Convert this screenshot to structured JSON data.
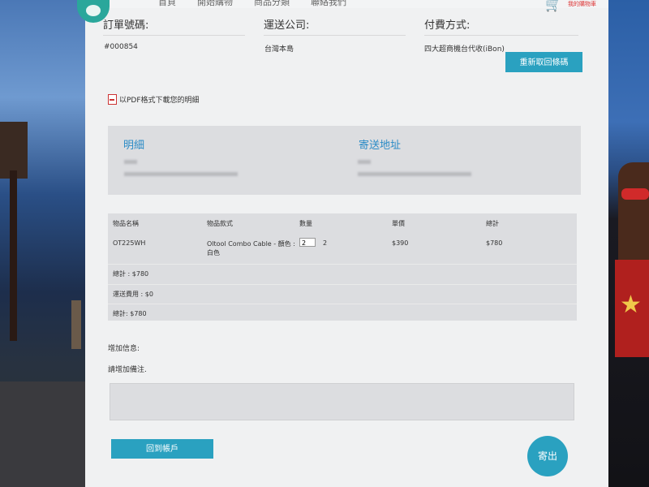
{
  "nav": {
    "items": [
      "首頁",
      "開始購物",
      "商品分類",
      "聯絡我們"
    ],
    "cart_label": "我的購物車"
  },
  "order_info": {
    "order_no_label": "訂單號碼:",
    "order_no": "#000854",
    "shipping_label": "運送公司:",
    "shipping_value": "台灣本島",
    "payment_label": "付費方式:",
    "payment_value": "四大超商機台代收(iBon)",
    "reissue_button": "重新取回條碼"
  },
  "pdf_link": "以PDF格式下載您的明細",
  "address": {
    "details_title": "明細",
    "ship_title": "寄送地址"
  },
  "table": {
    "headers": [
      "物品名稱",
      "物品款式",
      "數量",
      "單價",
      "總計"
    ],
    "rows": [
      {
        "name": "OT225WH",
        "style": "Oltool Combo Cable - 顏色 : 白色",
        "qty_input": "2",
        "qty": "2",
        "price": "$390",
        "total": "$780"
      }
    ],
    "summary": [
      {
        "label": "總計 : $780"
      },
      {
        "label": "運送費用 : $0"
      },
      {
        "label": "總計: $780"
      }
    ]
  },
  "notes": {
    "add_info_label": "增加信息:",
    "add_note_label": "請增加備注."
  },
  "buttons": {
    "back_to_account": "回到帳戶",
    "submit": "寄出"
  }
}
